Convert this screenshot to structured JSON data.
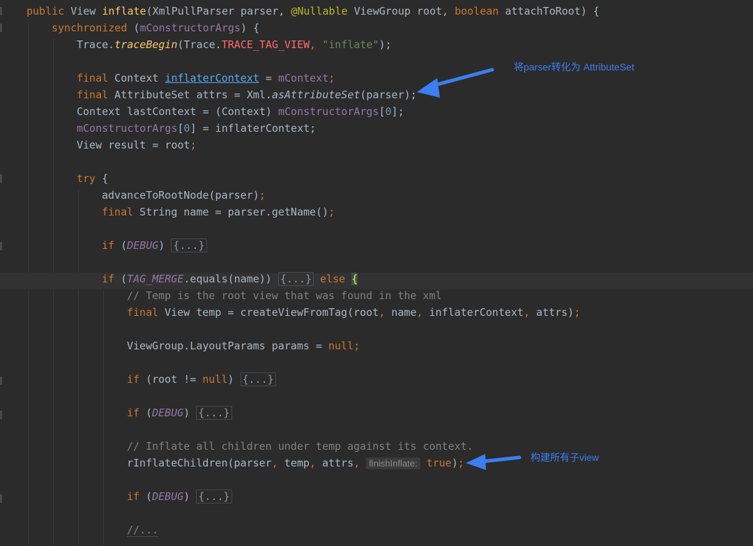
{
  "code": {
    "l1": {
      "a": "public",
      "b": "View",
      "c": "inflate",
      "d": "(XmlPullParser parser, ",
      "e": "@Nullable",
      "f": " ViewGroup root, ",
      "g": "boolean",
      "h": " attachToRoot) {"
    },
    "l2": {
      "a": "synchronized",
      "b": " (",
      "c": "mConstructorArgs",
      "d": ") {"
    },
    "l3": {
      "a": "Trace.",
      "b": "traceBegin",
      "c": "(Trace.",
      "d": "TRACE_TAG_VIEW",
      ",": ", ",
      "e": "\"inflate\"",
      "f": ");"
    },
    "l5": {
      "a": "final",
      "b": " Context ",
      "c": "inflaterContext",
      "d": " = ",
      "e": "mContext",
      ";": ";"
    },
    "l6": {
      "a": "final",
      "b": " AttributeSet attrs = Xml.",
      "c": "asAttributeSet",
      "d": "(parser);"
    },
    "l7": {
      "a": "Context lastContext = (Context) ",
      "b": "mConstructorArgs",
      "c": "[",
      "d": "0",
      "e": "];"
    },
    "l8": {
      "a": "mConstructorArgs",
      "b": "[",
      "c": "0",
      "d": "] = inflaterContext;"
    },
    "l9": {
      "a": "View result = root",
      ";": ";"
    },
    "l11": {
      "a": "try",
      "b": " {"
    },
    "l12": {
      "a": "advanceToRootNode(parser)",
      ";": ";"
    },
    "l13": {
      "a": "final",
      "b": " String name = parser.getName()",
      ";": ";"
    },
    "l15": {
      "a": "if",
      "b": " (",
      "c": "DEBUG",
      "d": ") ",
      "e": "{...}"
    },
    "l17": {
      "a": "if",
      "b": " (",
      "c": "TAG_MERGE",
      "d": ".equals(name)) ",
      "e": "{...}",
      "f": " else ",
      "g": "{"
    },
    "l18": {
      "a": "// Temp is the root view that was found in the xml"
    },
    "l19": {
      "a": "final",
      "b": " View temp = createViewFromTag(root",
      ",1": ", ",
      "c": "name",
      ",2": ", ",
      "d": "inflaterContext",
      ",3": ", ",
      "e": "attrs)",
      ";": ";"
    },
    "l21": {
      "a": "ViewGroup.LayoutParams params = ",
      "b": "null",
      ";": ";"
    },
    "l23": {
      "a": "if",
      "b": " (root != ",
      "c": "null",
      "d": ") ",
      "e": "{...}"
    },
    "l25": {
      "a": "if",
      "b": " (",
      "c": "DEBUG",
      "d": ") ",
      "e": "{...}"
    },
    "l27": {
      "a": "// Inflate all children under temp against its context."
    },
    "l28": {
      "a": "rInflateChildren(parser",
      ",1": ", ",
      "b": "temp",
      ",2": ", ",
      "c": "attrs",
      ",3": ", ",
      "hint": "finishInflate:",
      "d": "true",
      "e": ")",
      ";": ";"
    },
    "l30": {
      "a": "if",
      "b": " (",
      "c": "DEBUG",
      "d": ") ",
      "e": "{...}"
    },
    "l32": {
      "a": "//..."
    }
  },
  "annotations": {
    "parser_note": "将parser转化为 AttributeSet",
    "children_note": "构建所有子view",
    "color": "#3d7ef0"
  }
}
